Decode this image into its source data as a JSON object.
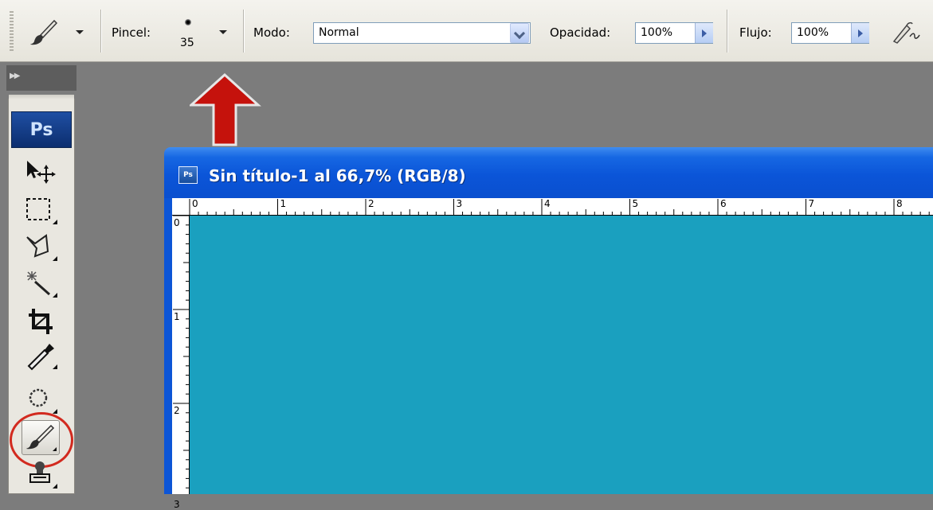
{
  "options_bar": {
    "tool_icon": "brush-icon",
    "brush_label": "Pincel:",
    "brush_size": "35",
    "mode_label": "Modo:",
    "mode_value": "Normal",
    "opacity_label": "Opacidad:",
    "opacity_value": "100%",
    "flow_label": "Flujo:",
    "flow_value": "100%",
    "airbrush_icon": "airbrush-icon"
  },
  "toolbox": {
    "collapse_icon": "double-chevron-right-icon",
    "logo": "Ps",
    "tools": [
      {
        "name": "move-tool-icon"
      },
      {
        "name": "marquee-tool-icon"
      },
      {
        "name": "lasso-tool-icon"
      },
      {
        "name": "magic-wand-tool-icon"
      },
      {
        "name": "crop-tool-icon"
      },
      {
        "name": "eyedropper-tool-icon"
      },
      {
        "name": "spot-healing-tool-icon"
      },
      {
        "name": "brush-tool-icon",
        "selected": true
      },
      {
        "name": "clone-stamp-tool-icon"
      }
    ]
  },
  "annotations": {
    "arrow_color": "#c5120c",
    "circle_color": "#d22a1f"
  },
  "document": {
    "title": "Sin título-1 al 66,7% (RGB/8)",
    "canvas_color": "#1aa0bf",
    "h_ruler_labels": [
      "0",
      "1",
      "2",
      "3",
      "4",
      "5",
      "6",
      "7",
      "8"
    ],
    "v_ruler_labels": [
      "0",
      "1",
      "2",
      "3"
    ]
  }
}
